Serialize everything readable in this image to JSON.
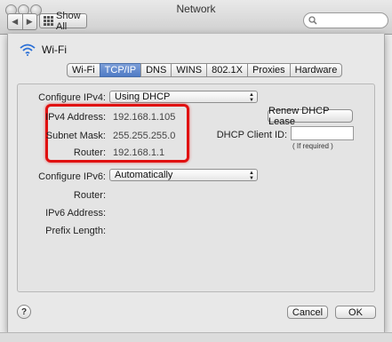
{
  "window": {
    "title": "Network"
  },
  "toolbar": {
    "show_all_label": "Show All"
  },
  "sheet": {
    "interface_name": "Wi-Fi",
    "tabs": [
      {
        "label": "Wi-Fi",
        "active": false
      },
      {
        "label": "TCP/IP",
        "active": true
      },
      {
        "label": "DNS",
        "active": false
      },
      {
        "label": "WINS",
        "active": false
      },
      {
        "label": "802.1X",
        "active": false
      },
      {
        "label": "Proxies",
        "active": false
      },
      {
        "label": "Hardware",
        "active": false
      }
    ],
    "ipv4": {
      "configure_label": "Configure IPv4:",
      "configure_value": "Using DHCP",
      "address_label": "IPv4 Address:",
      "address_value": "192.168.1.105",
      "subnet_label": "Subnet Mask:",
      "subnet_value": "255.255.255.0",
      "router_label": "Router:",
      "router_value": "192.168.1.1",
      "renew_button": "Renew DHCP Lease",
      "client_id_label": "DHCP Client ID:",
      "client_id_value": "",
      "client_id_hint": "( If required )"
    },
    "ipv6": {
      "configure_label": "Configure IPv6:",
      "configure_value": "Automatically",
      "router_label": "Router:",
      "address_label": "IPv6 Address:",
      "prefix_label": "Prefix Length:"
    },
    "buttons": {
      "help": "?",
      "cancel": "Cancel",
      "ok": "OK"
    }
  },
  "colors": {
    "highlight": "#e01010",
    "active_tab": "#4f7bc5"
  }
}
